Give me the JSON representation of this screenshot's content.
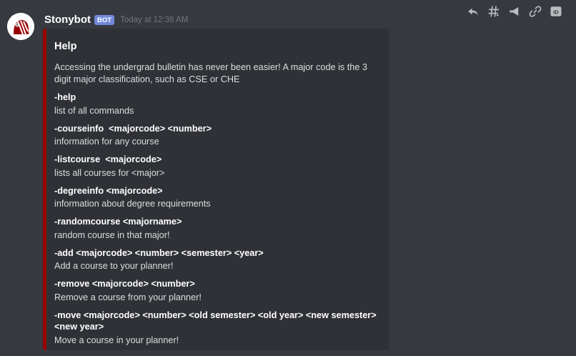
{
  "message": {
    "author": "Stonybot",
    "bot_tag": "BOT",
    "timestamp": "Today at 12:38 AM"
  },
  "toolbar": {
    "icons": [
      "reply-icon",
      "hashtag-icon",
      "megaphone-icon",
      "link-icon",
      "id-icon"
    ],
    "id_label": "ID"
  },
  "embed": {
    "accent_color": "#990000",
    "title": "Help",
    "description": "Accessing the undergrad bulletin has never been easier! A major code is the 3 digit major classification, such as CSE or CHE",
    "fields": [
      {
        "name": "-help",
        "value": "list of all commands"
      },
      {
        "name": "-courseinfo  <majorcode> <number>",
        "value": "information for any course"
      },
      {
        "name": "-listcourse  <majorcode>",
        "value": "lists all courses for <major>"
      },
      {
        "name": "-degreeinfo <majorcode>",
        "value": "information about degree requirements"
      },
      {
        "name": "-randomcourse <majorname>",
        "value": "random course in that major!"
      },
      {
        "name": "-add <majorcode> <number> <semester> <year>",
        "value": "Add a course to your planner!"
      },
      {
        "name": "-remove <majorcode> <number>",
        "value": "Remove a course from your planner!"
      },
      {
        "name": "-move <majorcode> <number> <old semester> <old year> <new semester> <new year>",
        "value": "Move a course in your planner!"
      }
    ]
  }
}
